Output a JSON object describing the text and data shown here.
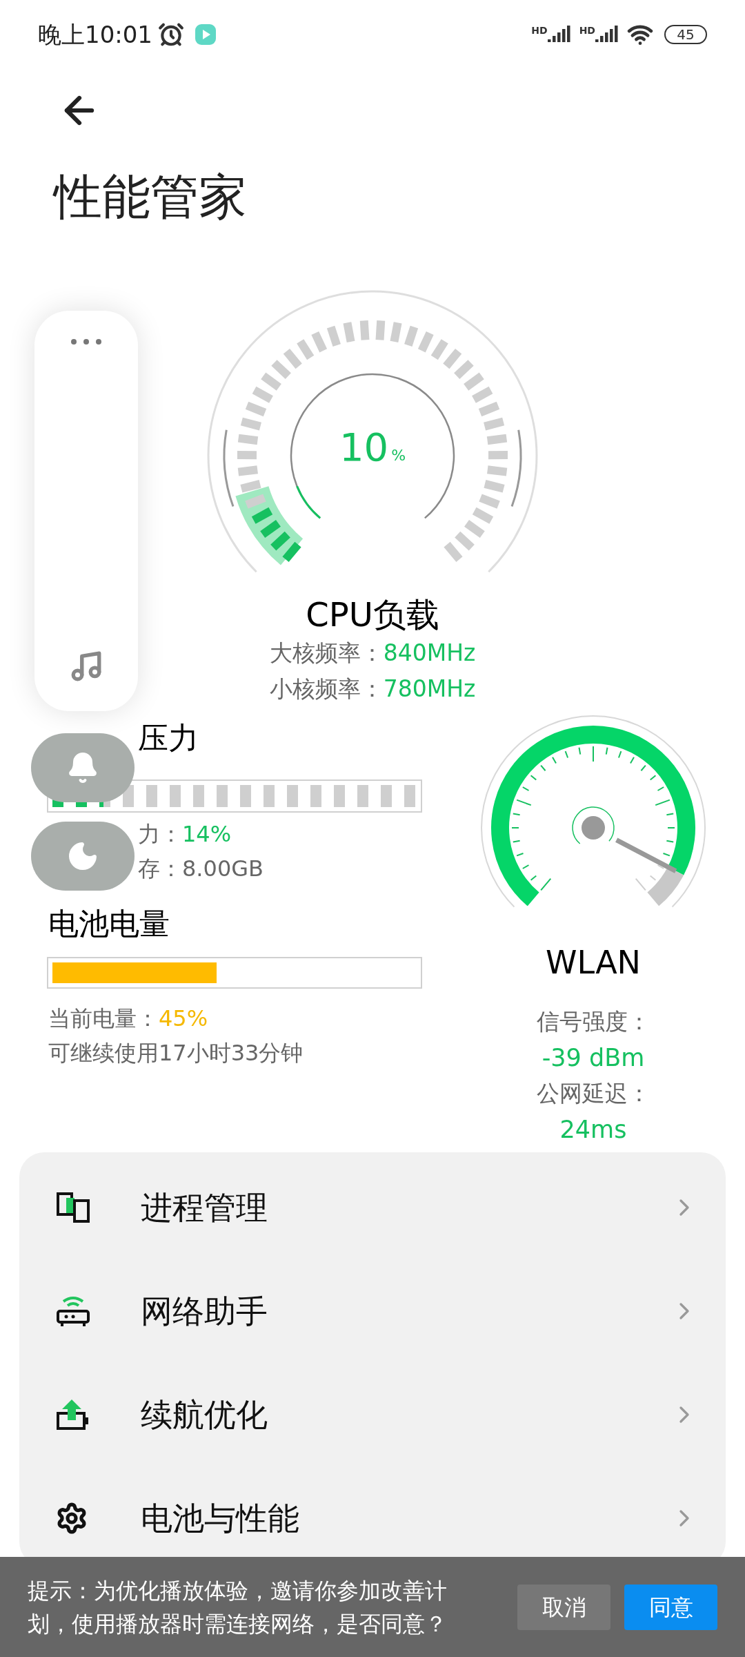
{
  "status_bar": {
    "time": "晚上10:01",
    "signals": [
      {
        "label": "HD"
      },
      {
        "label": "HD"
      }
    ],
    "battery": "45"
  },
  "title": "性能管家",
  "cpu": {
    "value": "10",
    "unit": "%",
    "label": "CPU负载",
    "rows": [
      {
        "label": "大核频率：",
        "value": "840MHz"
      },
      {
        "label": "小核频率：",
        "value": "780MHz"
      }
    ]
  },
  "memory": {
    "title": "压力",
    "level": 0.14,
    "rows": [
      {
        "label": "力：",
        "value": "14%"
      },
      {
        "label": "存：",
        "value": "8.00GB"
      }
    ]
  },
  "battery": {
    "title": "电池电量",
    "level": 0.45,
    "rows": [
      {
        "label": "当前电量：",
        "value": "45%"
      }
    ],
    "note": "可继续使用17小时33分钟"
  },
  "wlan": {
    "title": "WLAN",
    "rows": [
      {
        "label": "信号强度：",
        "value": "-39 dBm"
      },
      {
        "label": "公网延迟：",
        "value": "24ms"
      }
    ]
  },
  "menu": [
    {
      "kind": "process",
      "label": "进程管理"
    },
    {
      "kind": "network",
      "label": "网络助手"
    },
    {
      "kind": "endurance",
      "label": "续航优化"
    },
    {
      "kind": "performance",
      "label": "电池与性能"
    }
  ],
  "toast": {
    "text": "提示：为优化播放体验，邀请你参加改善计划，使用播放器时需连接网络，是否同意？",
    "buttons": [
      {
        "kind": "secondary",
        "label": "取消"
      },
      {
        "kind": "primary",
        "label": "同意"
      }
    ]
  }
}
